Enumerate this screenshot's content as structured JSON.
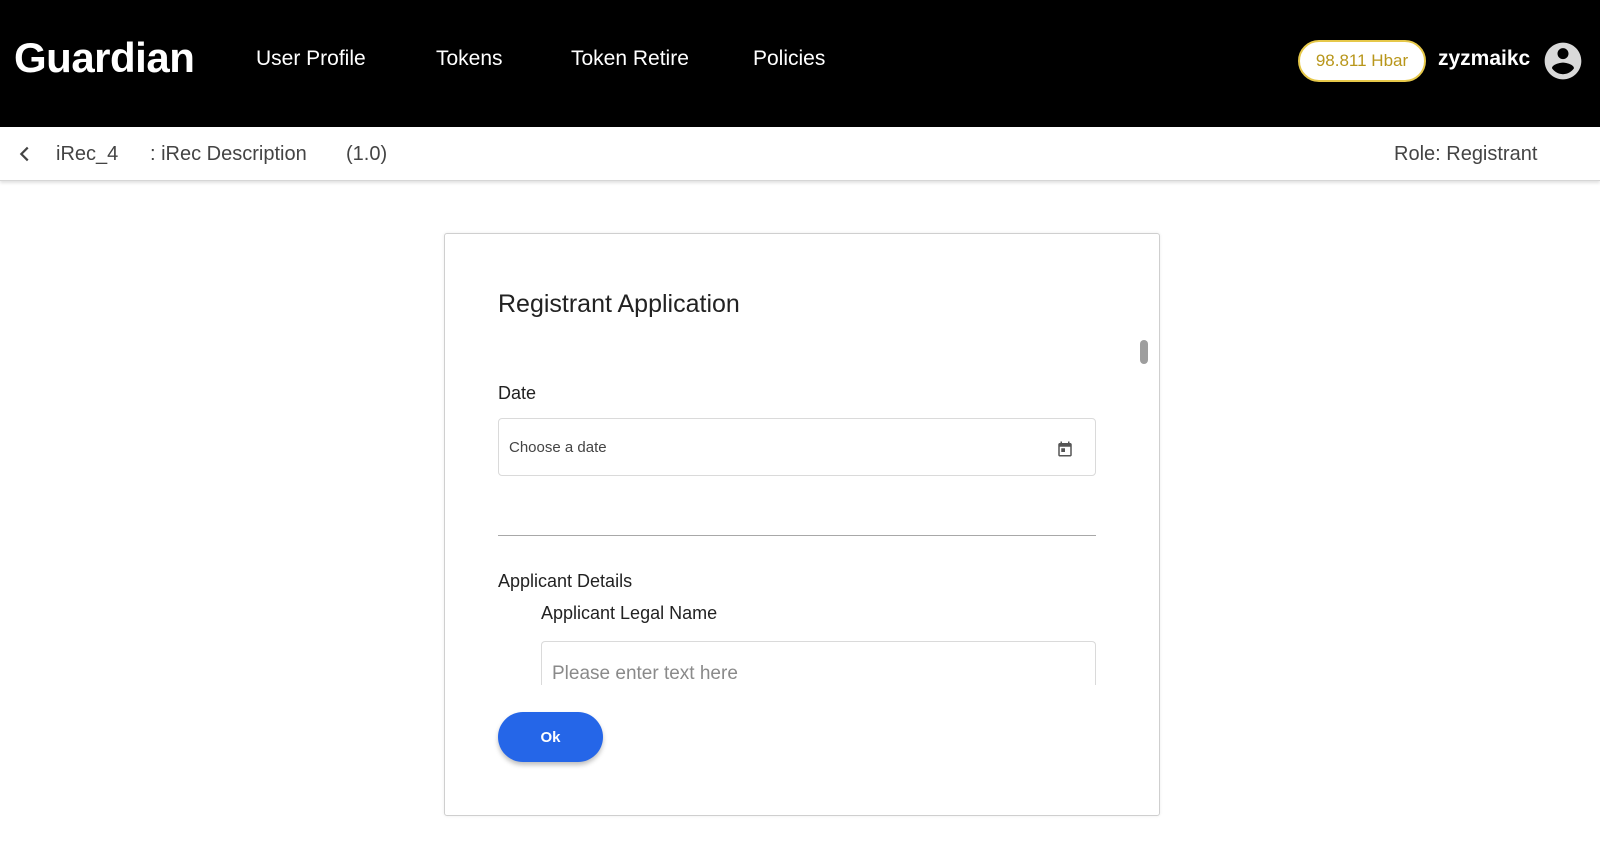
{
  "header": {
    "brand": "Guardian",
    "nav": [
      "User Profile",
      "Tokens",
      "Token Retire",
      "Policies"
    ],
    "balance": "98.811 Hbar",
    "username": "zyzmaikc",
    "avatar_icon": "account-circle-icon"
  },
  "subbar": {
    "policy_name": "iRec_4",
    "policy_description": ": iRec Description",
    "policy_version": "(1.0)",
    "role": "Role: Registrant"
  },
  "dialog": {
    "title": "Registrant Application",
    "date_label": "Date",
    "date_placeholder": "Choose a date",
    "section_title": "Applicant Details",
    "legal_name_label": "Applicant Legal Name",
    "legal_name_placeholder": "Please enter text here",
    "ok_label": "Ok"
  },
  "colors": {
    "header_bg": "#000000",
    "balance_text": "#b8961a",
    "balance_border": "#e6c84a",
    "primary_button": "#2566e8"
  }
}
